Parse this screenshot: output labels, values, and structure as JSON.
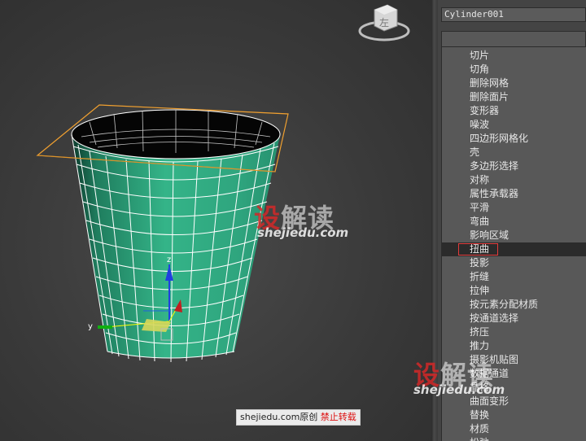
{
  "viewport": {
    "viewcube_label": "左",
    "watermark_1": {
      "brand_part1": "设",
      "brand_part2": "解读",
      "site": "shejiedu.com"
    },
    "watermark_2": {
      "brand_part1": "设",
      "brand_part2": "解读",
      "site": "shejiedu.com"
    },
    "gizmo_labels": {
      "z": "z",
      "y": "y"
    },
    "credit": {
      "site": "shejiedu.com",
      "original": "原创",
      "forbid": "禁止转载"
    },
    "colors": {
      "object": "#2fa57e",
      "wire": "#ffffff",
      "twist_gizmo": "#f0a030"
    }
  },
  "panel": {
    "object_name": "Cylinder001",
    "modifier_dropdown_value": "",
    "modifier_list": [
      "切片",
      "切角",
      "删除网格",
      "删除面片",
      "变形器",
      "噪波",
      "四边形网格化",
      "壳",
      "多边形选择",
      "对称",
      "属性承载器",
      "平滑",
      "弯曲",
      "影响区域",
      "扭曲",
      "投影",
      "折缝",
      "拉伸",
      "按元素分配材质",
      "按通道选择",
      "挤压",
      "推力",
      "摄影机贴图",
      "数据通道",
      "晶格",
      "曲面变形",
      "替换",
      "材质",
      "松弛"
    ],
    "selected_index": 14
  }
}
